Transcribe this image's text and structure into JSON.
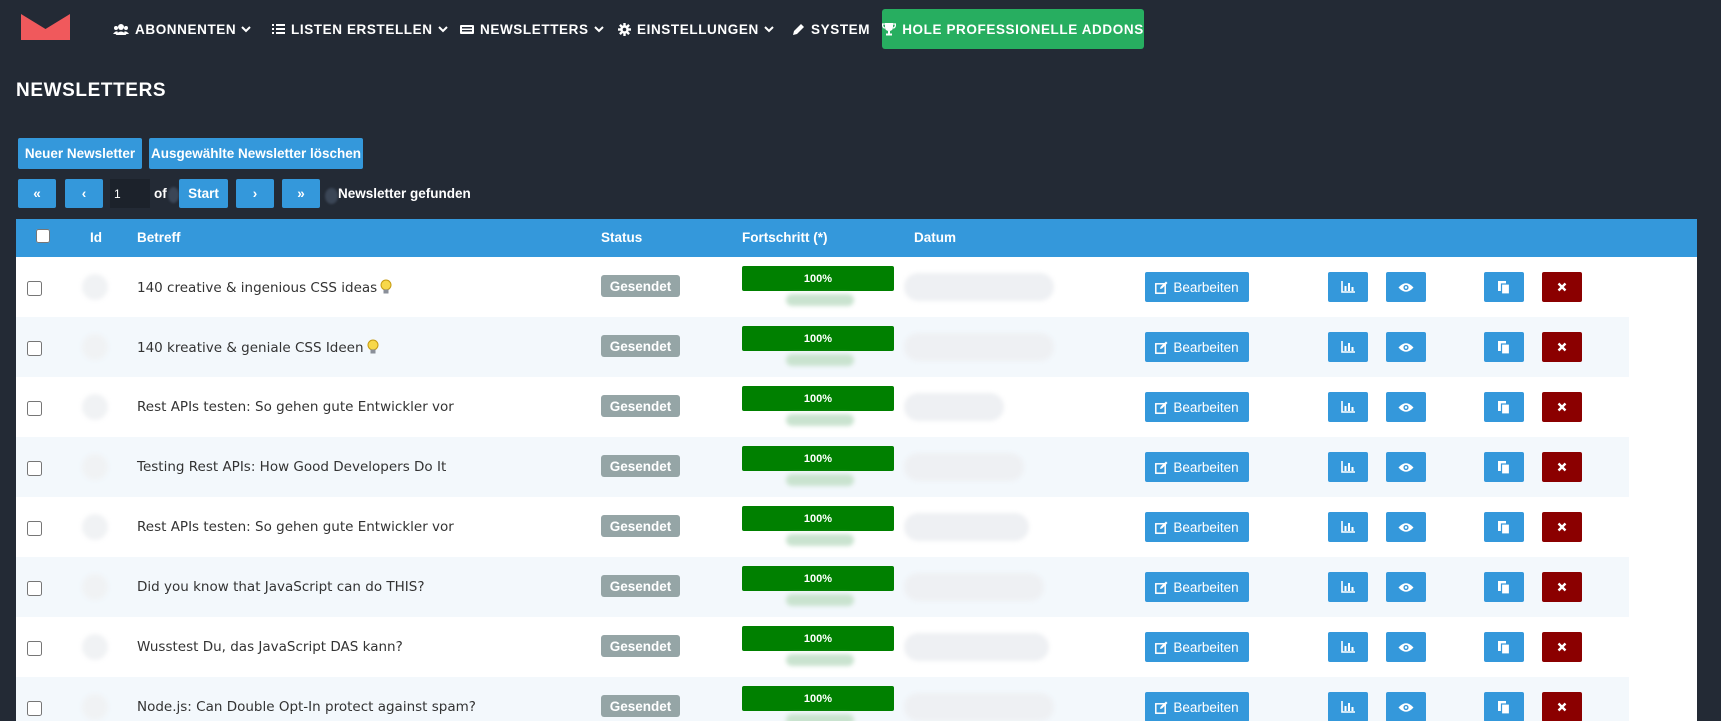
{
  "nav": {
    "items": [
      {
        "label": "ABONNENTEN",
        "icon": "users-icon"
      },
      {
        "label": "LISTEN ERSTELLEN",
        "icon": "list-icon"
      },
      {
        "label": "NEWSLETTERS",
        "icon": "newspaper-icon"
      },
      {
        "label": "EINSTELLUNGEN",
        "icon": "gear-icon"
      },
      {
        "label": "SYSTEM",
        "icon": "pencil-icon"
      }
    ],
    "addons_label": "HOLE PROFESSIONELLE ADDONS",
    "colors": {
      "background": "#232a35",
      "accent": "#3498db",
      "addons": "#27ae60",
      "logo": "#f0595c"
    }
  },
  "page": {
    "title": "NEWSLETTERS"
  },
  "toolbar": {
    "new_label": "Neuer Newsletter",
    "delete_selected_label": "Ausgewählte Newsletter löschen"
  },
  "pager": {
    "first": "«",
    "prev": "‹",
    "page_value": "1",
    "of_label": "of",
    "start_label": "Start",
    "next": "›",
    "last": "»",
    "found_label": "Newsletter gefunden"
  },
  "table": {
    "headers": {
      "id": "Id",
      "subject": "Betreff",
      "status": "Status",
      "progress": "Fortschritt (*)",
      "date": "Datum"
    },
    "edit_label": "Bearbeiten",
    "rows": [
      {
        "subject": "140 creative & ingenious CSS ideas",
        "bulb": true,
        "status": "Gesendet",
        "progress": "100%"
      },
      {
        "subject": "140 kreative & geniale CSS Ideen",
        "bulb": true,
        "status": "Gesendet",
        "progress": "100%"
      },
      {
        "subject": "Rest APIs testen: So gehen gute Entwickler vor",
        "bulb": false,
        "status": "Gesendet",
        "progress": "100%"
      },
      {
        "subject": "Testing Rest APIs: How Good Developers Do It",
        "bulb": false,
        "status": "Gesendet",
        "progress": "100%"
      },
      {
        "subject": "Rest APIs testen: So gehen gute Entwickler vor",
        "bulb": false,
        "status": "Gesendet",
        "progress": "100%"
      },
      {
        "subject": "Did you know that JavaScript can do THIS?",
        "bulb": false,
        "status": "Gesendet",
        "progress": "100%"
      },
      {
        "subject": "Wusstest Du, das JavaScript DAS kann?",
        "bulb": false,
        "status": "Gesendet",
        "progress": "100%"
      },
      {
        "subject": "Node.js: Can Double Opt-In protect against spam?",
        "bulb": false,
        "status": "Gesendet",
        "progress": "100%"
      }
    ]
  }
}
